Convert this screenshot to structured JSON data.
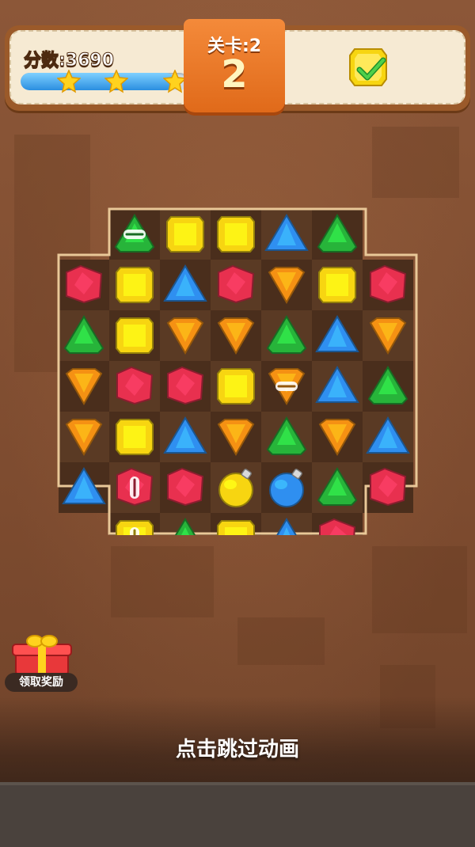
{
  "hud": {
    "score_label": "分数:3690",
    "progress": 0.92,
    "stars_earned": 3,
    "level_label": "关卡:2",
    "level_number": "2",
    "goal_icon": "yellow-gem-check-icon"
  },
  "board": {
    "rows": [
      [
        null,
        "green-line-h",
        "yellow",
        "yellow",
        "blue",
        "green",
        null
      ],
      [
        "red",
        "yellow",
        "blue",
        "red",
        "orange",
        "yellow",
        "red"
      ],
      [
        "green",
        "yellow",
        "orange",
        "orange",
        "green",
        "blue",
        "orange"
      ],
      [
        "orange",
        "red",
        "red",
        "yellow",
        "orange-line-h",
        "blue",
        "green"
      ],
      [
        "orange",
        "yellow",
        "blue",
        "orange",
        "green",
        "orange",
        "blue"
      ],
      [
        "blue",
        "red-line-v",
        "red",
        "yellow-bomb",
        "blue-bomb",
        "green",
        "red"
      ],
      [
        null,
        "yellow-line-v",
        "green",
        "yellow",
        "blue",
        "red",
        null
      ]
    ],
    "colors": {
      "red": "#e8304f",
      "yellow": "#f7d511",
      "blue": "#2f8ff0",
      "green": "#27b43a",
      "orange": "#f59113"
    }
  },
  "reward": {
    "label": "领取奖励",
    "icon": "gift-box-icon"
  },
  "skip_text": "点击跳过动画"
}
